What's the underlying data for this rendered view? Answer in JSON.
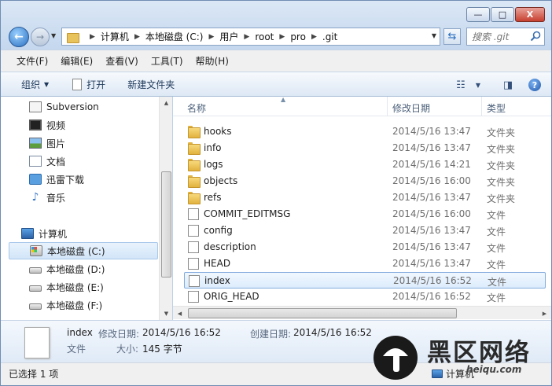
{
  "window": {
    "controls": {
      "minimize": "—",
      "maximize": "□",
      "close": "X"
    }
  },
  "nav": {
    "back_glyph": "←",
    "forward_glyph": "→"
  },
  "address": {
    "crumbs": [
      "计算机",
      "本地磁盘 (C:)",
      "用户",
      "root",
      "pro",
      ".git"
    ]
  },
  "search": {
    "placeholder": "搜索 .git"
  },
  "menu": [
    "文件(F)",
    "编辑(E)",
    "查看(V)",
    "工具(T)",
    "帮助(H)"
  ],
  "toolbar": {
    "organize": "组织",
    "open": "打开",
    "new_folder": "新建文件夹"
  },
  "sidebar": {
    "items": [
      {
        "label": "Subversion",
        "icon": "subversion-icon"
      },
      {
        "label": "视频",
        "icon": "video-library-icon"
      },
      {
        "label": "图片",
        "icon": "pictures-library-icon"
      },
      {
        "label": "文档",
        "icon": "documents-library-icon"
      },
      {
        "label": "迅雷下载",
        "icon": "thunder-download-icon"
      },
      {
        "label": "音乐",
        "icon": "music-library-icon"
      }
    ],
    "computer": "计算机",
    "drives": [
      {
        "label": "本地磁盘 (C:)",
        "selected": true
      },
      {
        "label": "本地磁盘 (D:)"
      },
      {
        "label": "本地磁盘 (E:)"
      },
      {
        "label": "本地磁盘 (F:)"
      }
    ]
  },
  "columns": {
    "name": "名称",
    "modified": "修改日期",
    "type": "类型"
  },
  "files": [
    {
      "name": "hooks",
      "date": "2014/5/16 13:47",
      "type": "文件夹",
      "kind": "folder"
    },
    {
      "name": "info",
      "date": "2014/5/16 13:47",
      "type": "文件夹",
      "kind": "folder"
    },
    {
      "name": "logs",
      "date": "2014/5/16 14:21",
      "type": "文件夹",
      "kind": "folder"
    },
    {
      "name": "objects",
      "date": "2014/5/16 16:00",
      "type": "文件夹",
      "kind": "folder"
    },
    {
      "name": "refs",
      "date": "2014/5/16 13:47",
      "type": "文件夹",
      "kind": "folder"
    },
    {
      "name": "COMMIT_EDITMSG",
      "date": "2014/5/16 16:00",
      "type": "文件",
      "kind": "file"
    },
    {
      "name": "config",
      "date": "2014/5/16 13:47",
      "type": "文件",
      "kind": "file"
    },
    {
      "name": "description",
      "date": "2014/5/16 13:47",
      "type": "文件",
      "kind": "file"
    },
    {
      "name": "HEAD",
      "date": "2014/5/16 13:47",
      "type": "文件",
      "kind": "file"
    },
    {
      "name": "index",
      "date": "2014/5/16 16:52",
      "type": "文件",
      "kind": "file",
      "selected": true
    },
    {
      "name": "ORIG_HEAD",
      "date": "2014/5/16 16:52",
      "type": "文件",
      "kind": "file"
    }
  ],
  "details": {
    "name": "index",
    "modified_label": "修改日期:",
    "modified_value": "2014/5/16 16:52",
    "created_label": "创建日期:",
    "created_value": "2014/5/16 16:52",
    "type_value": "文件",
    "size_label": "大小:",
    "size_value": "145 字节"
  },
  "status": {
    "selected": "已选择 1 项",
    "location": "计算机"
  },
  "watermark": {
    "text": "黑区网络",
    "url": "heiqu.com"
  }
}
